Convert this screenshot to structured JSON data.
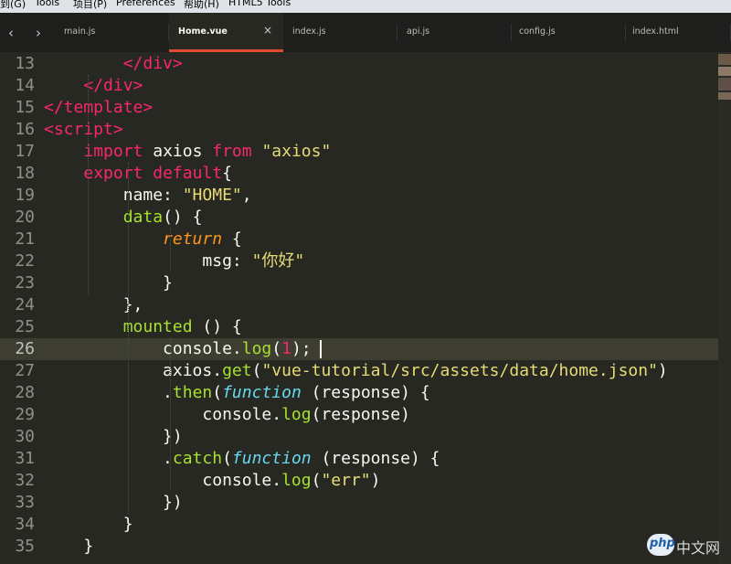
{
  "menubar": {
    "items": [
      "到(G)",
      "Tools",
      "项目(P)",
      "Preferences",
      "帮助(H)",
      "HTML5 Tools"
    ]
  },
  "navigation": {
    "back_icon": "chevron-left-icon",
    "forward_icon": "chevron-right-icon",
    "back_glyph": "‹",
    "forward_glyph": "›"
  },
  "tabs": [
    {
      "label": "main.js",
      "active": false
    },
    {
      "label": "Home.vue",
      "active": true,
      "close_glyph": "×"
    },
    {
      "label": "index.js",
      "active": false
    },
    {
      "label": "api.js",
      "active": false
    },
    {
      "label": "config.js",
      "active": false
    },
    {
      "label": "index.html",
      "active": false
    }
  ],
  "editor": {
    "current_line": 26,
    "lines": [
      {
        "num": "13",
        "text": "        </div>"
      },
      {
        "num": "14",
        "text": "    </div>"
      },
      {
        "num": "15",
        "text": "</template>"
      },
      {
        "num": "16",
        "text": "<script>"
      },
      {
        "num": "17",
        "text": "    import axios from \"axios\""
      },
      {
        "num": "18",
        "text": "    export default{"
      },
      {
        "num": "19",
        "text": "        name: \"HOME\","
      },
      {
        "num": "20",
        "text": "        data() {"
      },
      {
        "num": "21",
        "text": "            return {"
      },
      {
        "num": "22",
        "text": "                msg: \"你好\""
      },
      {
        "num": "23",
        "text": "            }"
      },
      {
        "num": "24",
        "text": "        },"
      },
      {
        "num": "25",
        "text": "        mounted () {"
      },
      {
        "num": "26",
        "text": "            console.log(1);"
      },
      {
        "num": "27",
        "text": "            axios.get(\"vue-tutorial/src/assets/data/home.json\")"
      },
      {
        "num": "28",
        "text": "            .then(function (response) {"
      },
      {
        "num": "29",
        "text": "                console.log(response)"
      },
      {
        "num": "30",
        "text": "            })"
      },
      {
        "num": "31",
        "text": "            .catch(function (response) {"
      },
      {
        "num": "32",
        "text": "                console.log(\"err\")"
      },
      {
        "num": "33",
        "text": "            })"
      },
      {
        "num": "34",
        "text": "        }"
      },
      {
        "num": "35",
        "text": "    }"
      }
    ]
  },
  "theme": {
    "background": "#272822",
    "tag": "#f92672",
    "string": "#e6db74",
    "function": "#a6e22e",
    "keyword_italic": "#fd971f",
    "method": "#66d9ef",
    "tab_accent": "#e04a2f"
  },
  "watermark": {
    "logo_text": "php",
    "text": "中文网"
  }
}
